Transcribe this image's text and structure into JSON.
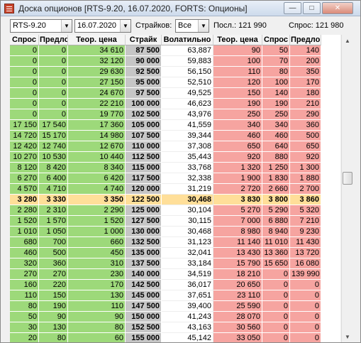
{
  "window": {
    "title": "Доска опционов [RTS-9.20, 16.07.2020, FORTS: Опционы]",
    "controls": {
      "minimize": "—",
      "maximize": "□",
      "close": "✕"
    }
  },
  "toolbar": {
    "security": "RTS-9.20",
    "expiry_date": "16.07.2020",
    "strikes_label": "Страйков:",
    "strikes_value": "Все",
    "last_label": "Посл.: 121 990",
    "bid_label": "Спрос: 121 980"
  },
  "colors": {
    "call_green": "#9dd97a",
    "put_red": "#f6a4a0",
    "strike_gray": "#c6c6c6",
    "atm_highlight": "#ffdf99"
  },
  "columns": [
    "Спрос",
    "Предло",
    "Теор. цена",
    "Страйк",
    "Волатильно",
    "Теор. цена",
    "Спрос",
    "Предло"
  ],
  "rows": [
    [
      "0",
      "0",
      "34 610",
      "87 500",
      "63,887",
      "90",
      "50",
      "140"
    ],
    [
      "0",
      "0",
      "32 120",
      "90 000",
      "59,883",
      "100",
      "70",
      "200"
    ],
    [
      "0",
      "0",
      "29 630",
      "92 500",
      "56,150",
      "110",
      "80",
      "350"
    ],
    [
      "0",
      "0",
      "27 150",
      "95 000",
      "52,510",
      "120",
      "100",
      "170"
    ],
    [
      "0",
      "0",
      "24 670",
      "97 500",
      "49,525",
      "150",
      "140",
      "180"
    ],
    [
      "0",
      "0",
      "22 210",
      "100 000",
      "46,623",
      "190",
      "190",
      "210"
    ],
    [
      "0",
      "0",
      "19 770",
      "102 500",
      "43,976",
      "250",
      "250",
      "290"
    ],
    [
      "17 150",
      "17 540",
      "17 360",
      "105 000",
      "41,559",
      "340",
      "340",
      "360"
    ],
    [
      "14 720",
      "15 170",
      "14 980",
      "107 500",
      "39,344",
      "460",
      "460",
      "500"
    ],
    [
      "12 420",
      "12 740",
      "12 670",
      "110 000",
      "37,308",
      "650",
      "640",
      "650"
    ],
    [
      "10 270",
      "10 530",
      "10 440",
      "112 500",
      "35,443",
      "920",
      "880",
      "920"
    ],
    [
      "8 120",
      "8 420",
      "8 340",
      "115 000",
      "33,768",
      "1 320",
      "1 250",
      "1 300"
    ],
    [
      "6 270",
      "6 400",
      "6 420",
      "117 500",
      "32,338",
      "1 900",
      "1 830",
      "1 880"
    ],
    [
      "4 570",
      "4 710",
      "4 740",
      "120 000",
      "31,219",
      "2 720",
      "2 660",
      "2 700"
    ],
    [
      "3 280",
      "3 330",
      "3 350",
      "122 500",
      "30,468",
      "3 830",
      "3 800",
      "3 860"
    ],
    [
      "2 280",
      "2 310",
      "2 290",
      "125 000",
      "30,104",
      "5 270",
      "5 290",
      "5 320"
    ],
    [
      "1 520",
      "1 570",
      "1 520",
      "127 500",
      "30,115",
      "7 000",
      "6 880",
      "7 210"
    ],
    [
      "1 010",
      "1 050",
      "1 000",
      "130 000",
      "30,468",
      "8 980",
      "8 940",
      "9 230"
    ],
    [
      "680",
      "700",
      "660",
      "132 500",
      "31,123",
      "11 140",
      "11 010",
      "11 430"
    ],
    [
      "460",
      "500",
      "450",
      "135 000",
      "32,041",
      "13 430",
      "13 360",
      "13 720"
    ],
    [
      "320",
      "360",
      "310",
      "137 500",
      "33,184",
      "15 790",
      "15 650",
      "16 080"
    ],
    [
      "270",
      "270",
      "230",
      "140 000",
      "34,519",
      "18 210",
      "0",
      "139 990"
    ],
    [
      "160",
      "220",
      "170",
      "142 500",
      "36,017",
      "20 650",
      "0",
      "0"
    ],
    [
      "110",
      "150",
      "130",
      "145 000",
      "37,651",
      "23 110",
      "0",
      "0"
    ],
    [
      "80",
      "190",
      "110",
      "147 500",
      "39,400",
      "25 590",
      "0",
      "0"
    ],
    [
      "50",
      "90",
      "90",
      "150 000",
      "41,243",
      "28 070",
      "0",
      "0"
    ],
    [
      "30",
      "130",
      "80",
      "152 500",
      "43,163",
      "30 560",
      "0",
      "0"
    ],
    [
      "20",
      "80",
      "60",
      "155 000",
      "45,142",
      "33 050",
      "0",
      "0"
    ]
  ],
  "atm_row_index": 14,
  "scroll": {
    "up": "▲",
    "down": "▼"
  }
}
